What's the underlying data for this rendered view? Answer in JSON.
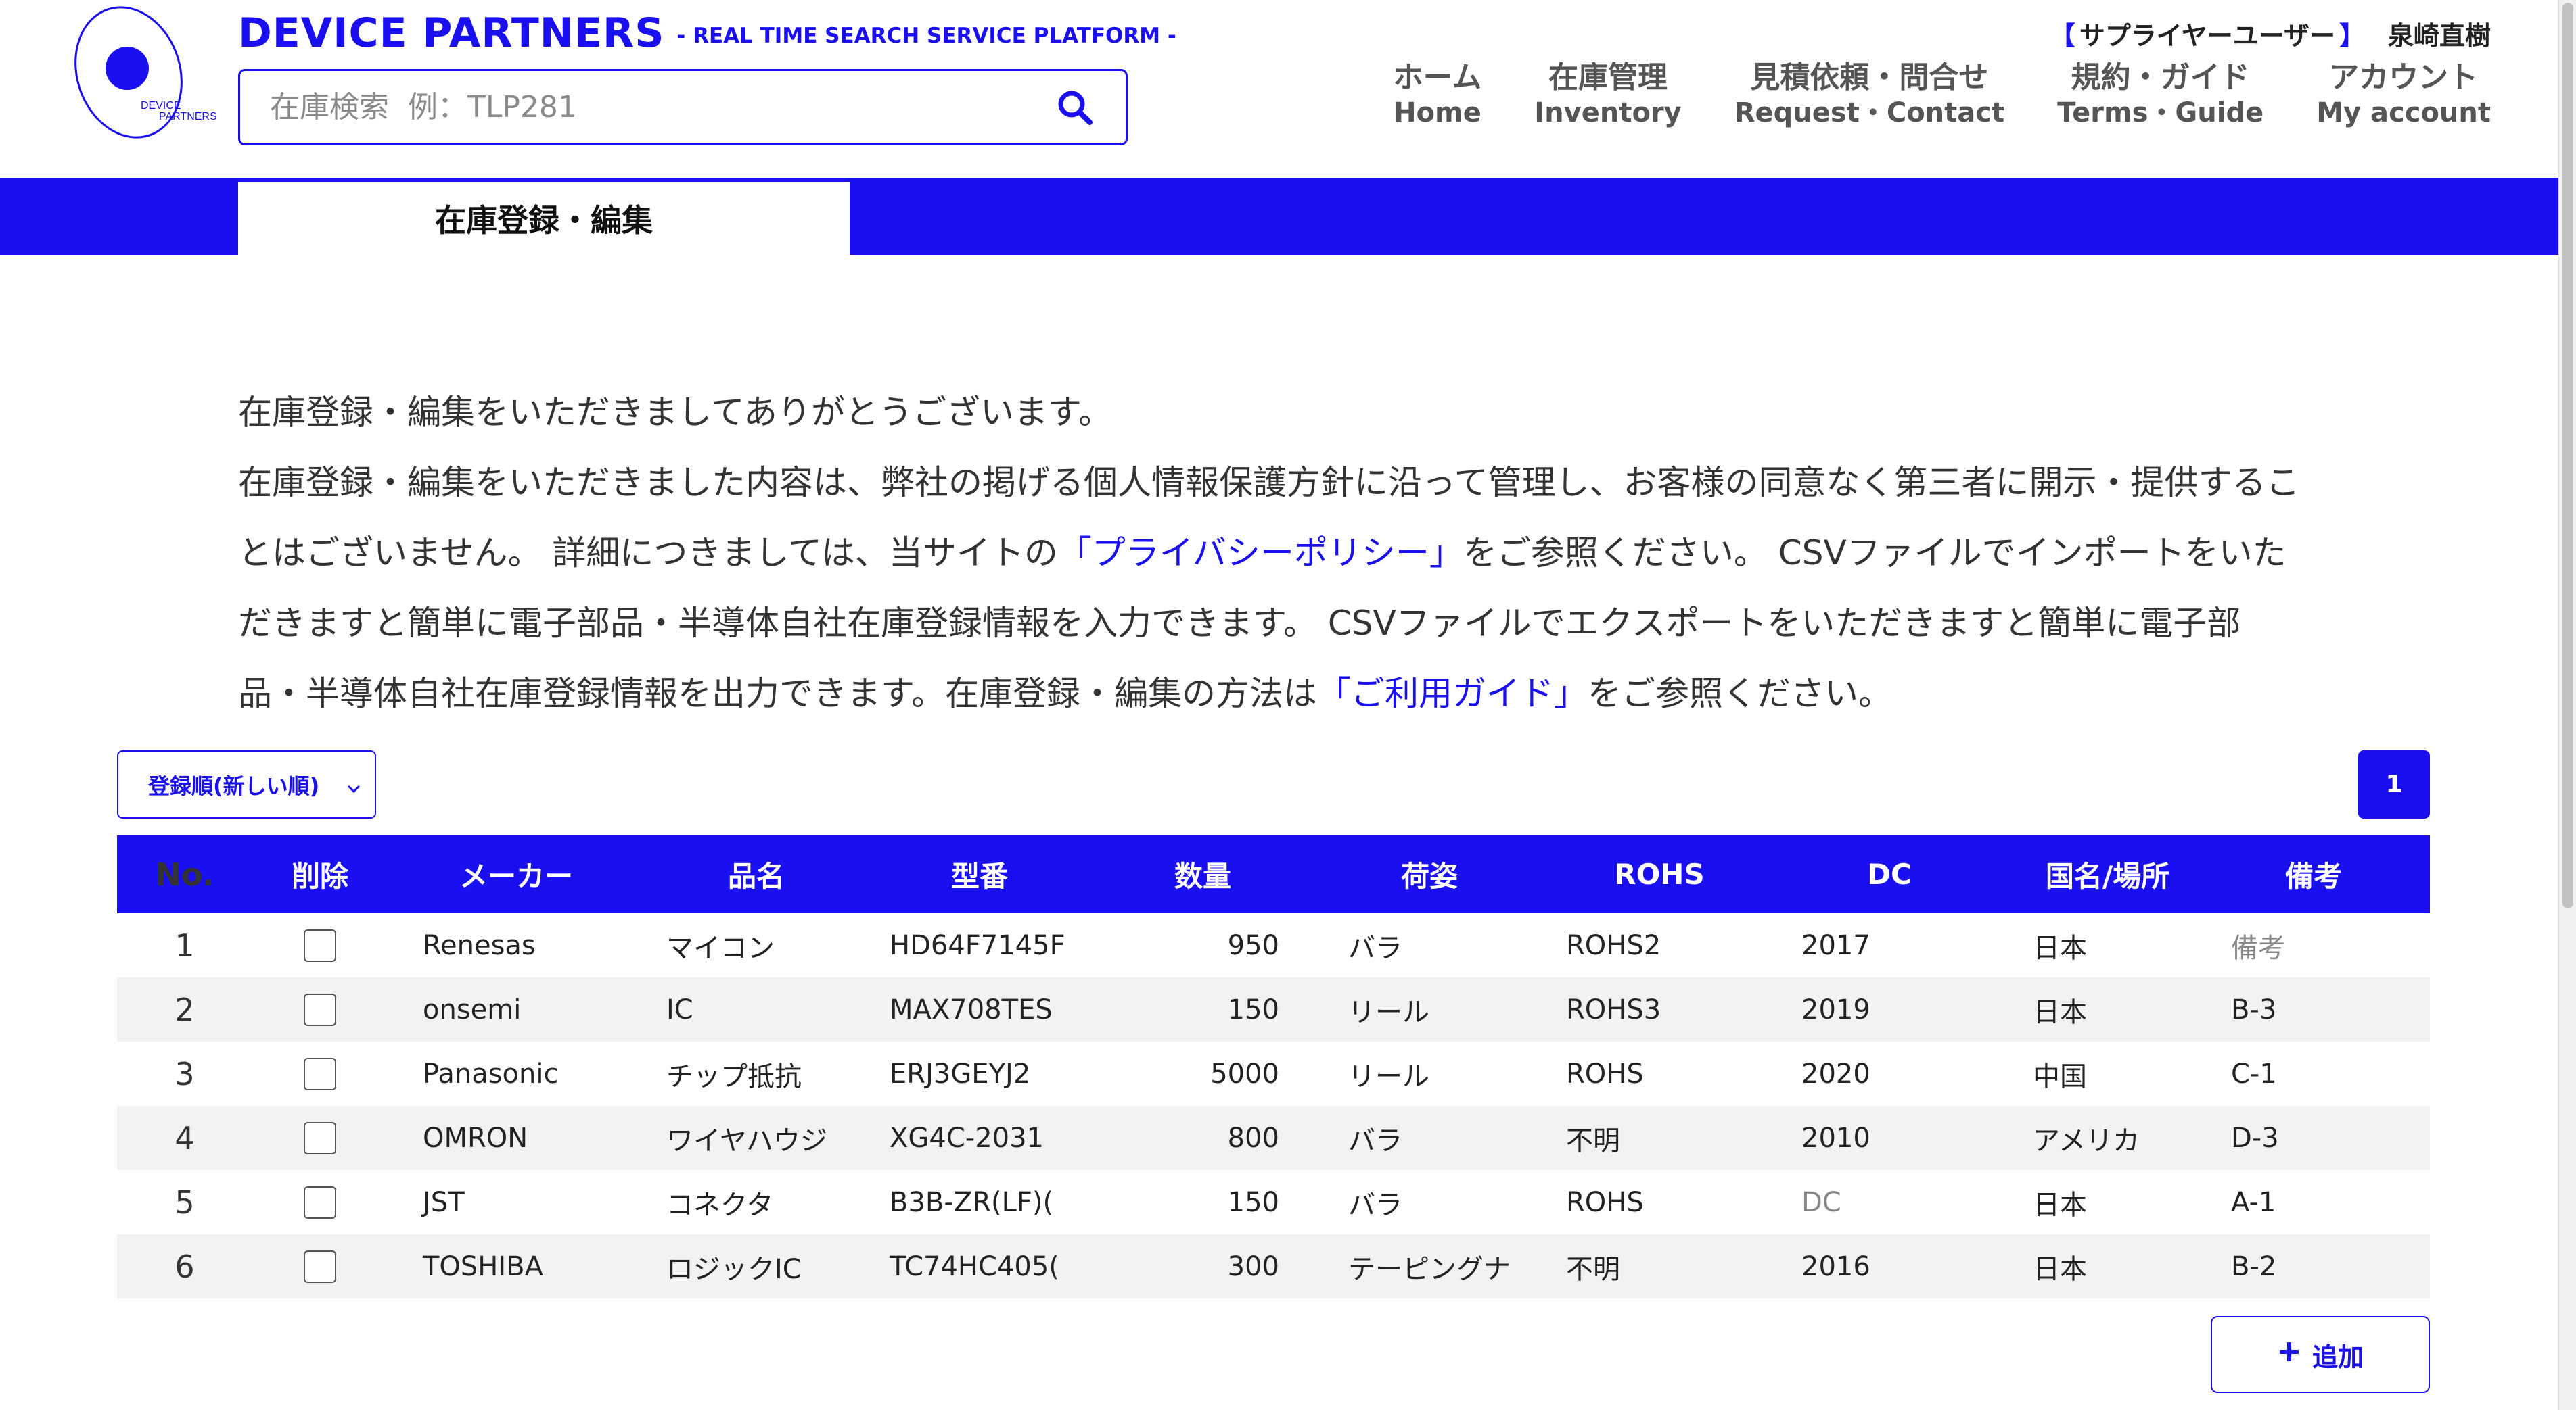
{
  "header": {
    "logo_text": "DEVICE PARTNERS",
    "brand_name": "DEVICE PARTNERS",
    "tagline": "- REAL TIME SEARCH SERVICE PLATFORM -",
    "search_placeholder": "在庫検索  例：TLP281",
    "user_role_open": "【",
    "user_role": "サプライヤーユーザー",
    "user_role_close": "】",
    "user_name": "泉崎直樹",
    "nav": [
      {
        "jp": "ホーム",
        "en": "Home"
      },
      {
        "jp": "在庫管理",
        "en": "Inventory"
      },
      {
        "jp": "見積依頼・問合せ",
        "en": "Request・Contact"
      },
      {
        "jp": "規約・ガイド",
        "en": "Terms・Guide"
      },
      {
        "jp": "アカウント",
        "en": "My account"
      }
    ]
  },
  "tabs": {
    "active": "在庫登録・編集"
  },
  "intro": {
    "line1": "在庫登録・編集をいただきましてありがとうございます。",
    "p2a": "在庫登録・編集をいただきました内容は、弊社の掲げる個人情報保護方針に沿って管理し、お客様の同意なく第三者に開示・提供することはございません。 詳細につきましては、当サイトの",
    "privacy_link": "「プライバシーポリシー」",
    "p2b": "をご参照ください。 CSVファイルでインポートをいただきますと簡単に電子部品・半導体自社在庫登録情報を入力できます。 CSVファイルでエクスポートをいただきますと簡単に電子部品・半導体自社在庫登録情報を出力できます。在庫登録・編集の方法は",
    "guide_link": "「ご利用ガイド」",
    "p2c": "をご参照ください。"
  },
  "controls": {
    "sort_label": "登録順(新しい順)",
    "page": "1",
    "add_label": "追加"
  },
  "table": {
    "headers": [
      "No.",
      "削除",
      "メーカー",
      "品名",
      "型番",
      "数量",
      "荷姿",
      "ROHS",
      "DC",
      "国名/場所",
      "備考"
    ],
    "rows": [
      {
        "no": "1",
        "maker": "Renesas",
        "name": "マイコン",
        "model": "HD64F7145F",
        "qty": "950",
        "pack": "バラ",
        "rohs": "ROHS2",
        "dc": "2017",
        "country": "日本",
        "remark": "備考"
      },
      {
        "no": "2",
        "maker": "onsemi",
        "name": "IC",
        "model": "MAX708TES",
        "qty": "150",
        "pack": "リール",
        "rohs": "ROHS3",
        "dc": "2019",
        "country": "日本",
        "remark": "B-3"
      },
      {
        "no": "3",
        "maker": "Panasonic",
        "name": "チップ抵抗",
        "model": "ERJ3GEYJ2",
        "qty": "5000",
        "pack": "リール",
        "rohs": "ROHS",
        "dc": "2020",
        "country": "中国",
        "remark": "C-1"
      },
      {
        "no": "4",
        "maker": "OMRON",
        "name": "ワイヤハウジ",
        "model": "XG4C-2031",
        "qty": "800",
        "pack": "バラ",
        "rohs": "不明",
        "dc": "2010",
        "country": "アメリカ",
        "remark": "D-3"
      },
      {
        "no": "5",
        "maker": "JST",
        "name": "コネクタ",
        "model": "B3B-ZR(LF)(",
        "qty": "150",
        "pack": "バラ",
        "rohs": "ROHS",
        "dc": "DC",
        "country": "日本",
        "remark": "A-1"
      },
      {
        "no": "6",
        "maker": "TOSHIBA",
        "name": "ロジックIC",
        "model": "TC74HC405(",
        "qty": "300",
        "pack": "テーピングナ",
        "rohs": "不明",
        "dc": "2016",
        "country": "日本",
        "remark": "B-2"
      }
    ]
  },
  "colors": {
    "brand": "#1a0ff0",
    "row_alt": "#f2f2f2",
    "text": "#333333"
  },
  "icons": {
    "search": "search-icon",
    "add": "plus-icon",
    "sort": "chevron-down-icon"
  }
}
